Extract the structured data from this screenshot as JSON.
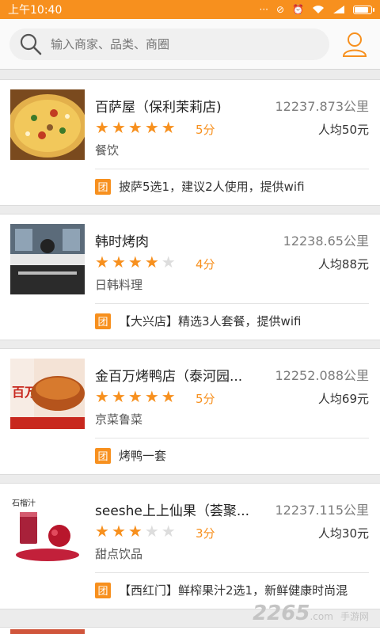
{
  "status": {
    "time": "上午10:40",
    "dots": "···"
  },
  "search": {
    "placeholder": "输入商家、品类、商圈"
  },
  "colors": {
    "accent": "#f7901e"
  },
  "items": [
    {
      "name": "百萨屋（保利茉莉店)",
      "distance": "12237.873公里",
      "rating": 5,
      "score": "5分",
      "price": "人均50元",
      "category": "餐饮",
      "badge": "团",
      "deal": "披萨5选1，建议2人使用，提供wifi"
    },
    {
      "name": "韩时烤肉",
      "distance": "12238.65公里",
      "rating": 4,
      "score": "4分",
      "price": "人均88元",
      "category": "日韩料理",
      "badge": "团",
      "deal": "【大兴店】精选3人套餐，提供wifi"
    },
    {
      "name": "金百万烤鸭店（泰河园...",
      "distance": "12252.088公里",
      "rating": 5,
      "score": "5分",
      "price": "人均69元",
      "category": "京菜鲁菜",
      "badge": "团",
      "deal": "烤鸭一套"
    },
    {
      "name": "seeshe上上仙果（荟聚...",
      "distance": "12237.115公里",
      "rating": 3,
      "score": "3分",
      "price": "人均30元",
      "category": "甜点饮品",
      "badge": "团",
      "deal": "【西红门】鲜榨果汁2选1，新鲜健康时尚混"
    }
  ],
  "thumb_text": {
    "duck_sign": "百万",
    "juice_sign": "石榴汁"
  },
  "watermark": {
    "text": "2265",
    "suffix": ".com",
    "sub": "手游网"
  }
}
